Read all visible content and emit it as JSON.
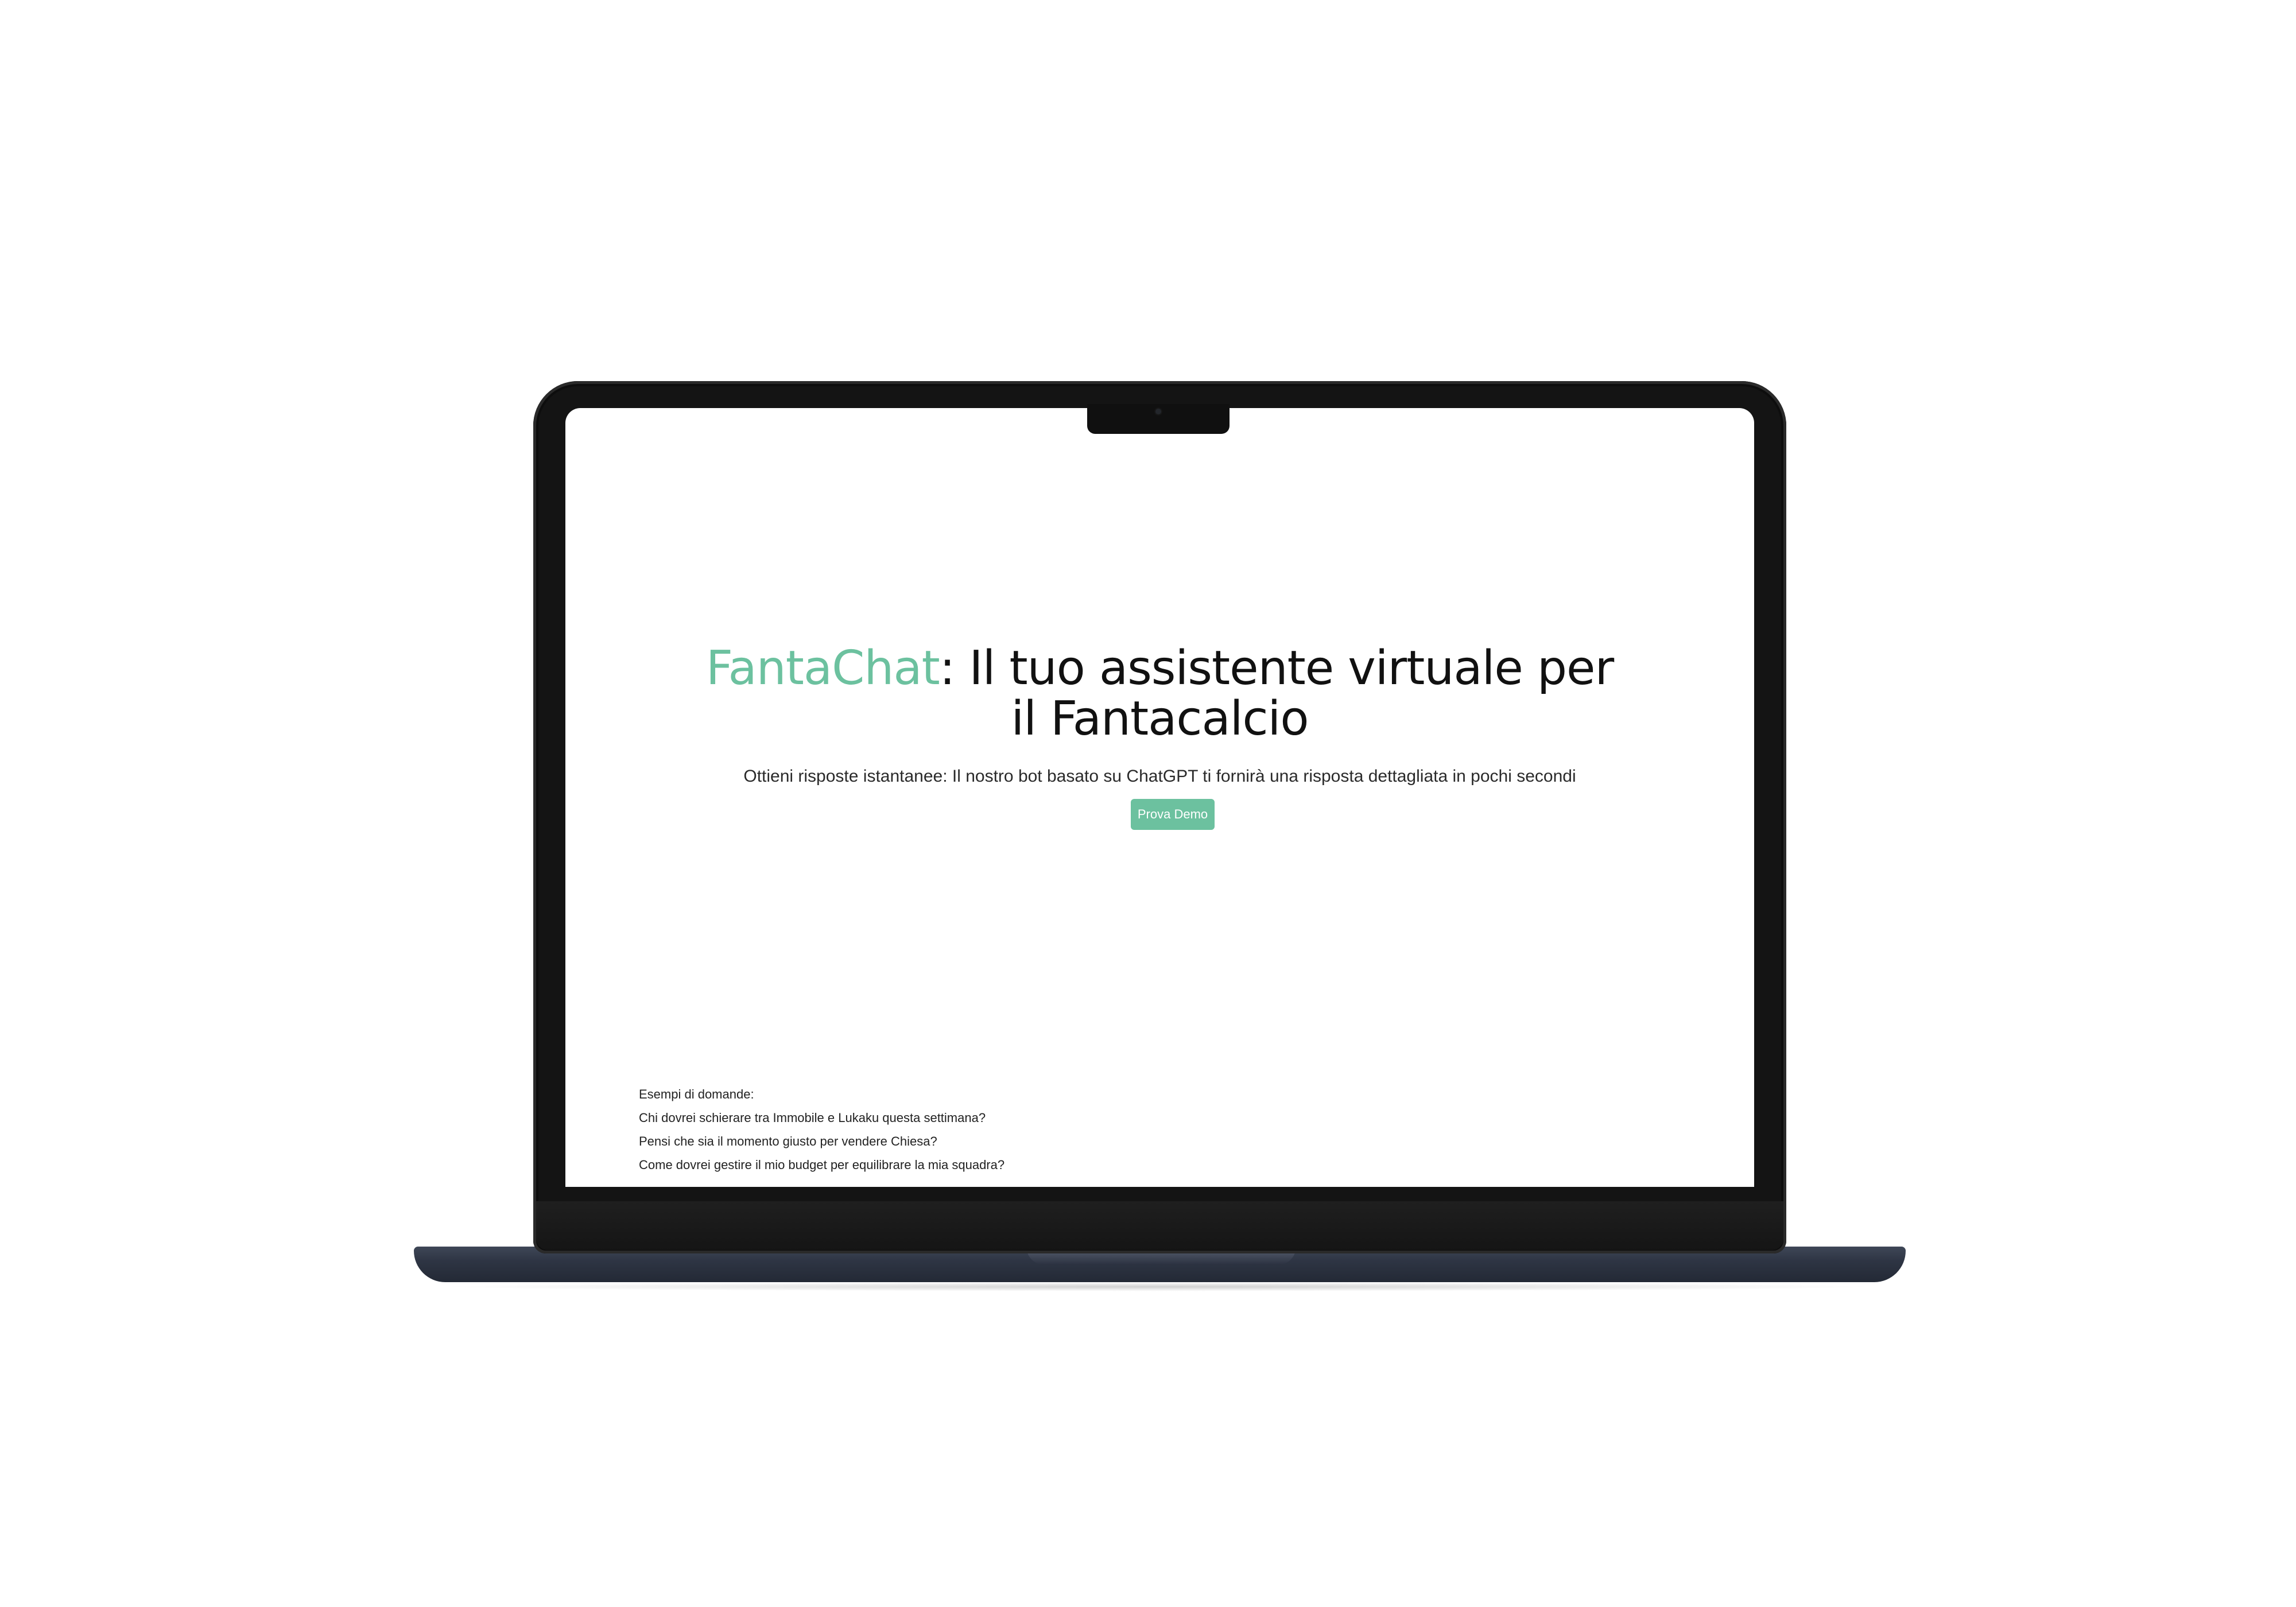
{
  "hero": {
    "brand": "FantaChat",
    "title_rest_line1": ": Il tuo assistente virtuale per",
    "title_line2": "il Fantacalcio",
    "subtitle": "Ottieni risposte istantanee: Il nostro bot basato su ChatGPT ti fornirà una risposta dettagliata in pochi secondi",
    "demo_button_label": "Prova Demo"
  },
  "examples": {
    "heading": "Esempi di domande:",
    "questions": [
      "Chi dovrei schierare tra Immobile e Lukaku questa settimana?",
      "Pensi che sia il momento giusto per vendere Chiesa?",
      "Come dovrei gestire il mio budget per equilibrare la mia squadra?"
    ]
  },
  "colors": {
    "accent": "#6cc19f",
    "text": "#111111",
    "laptop_frame": "#141414",
    "laptop_base": "#2e3544"
  }
}
